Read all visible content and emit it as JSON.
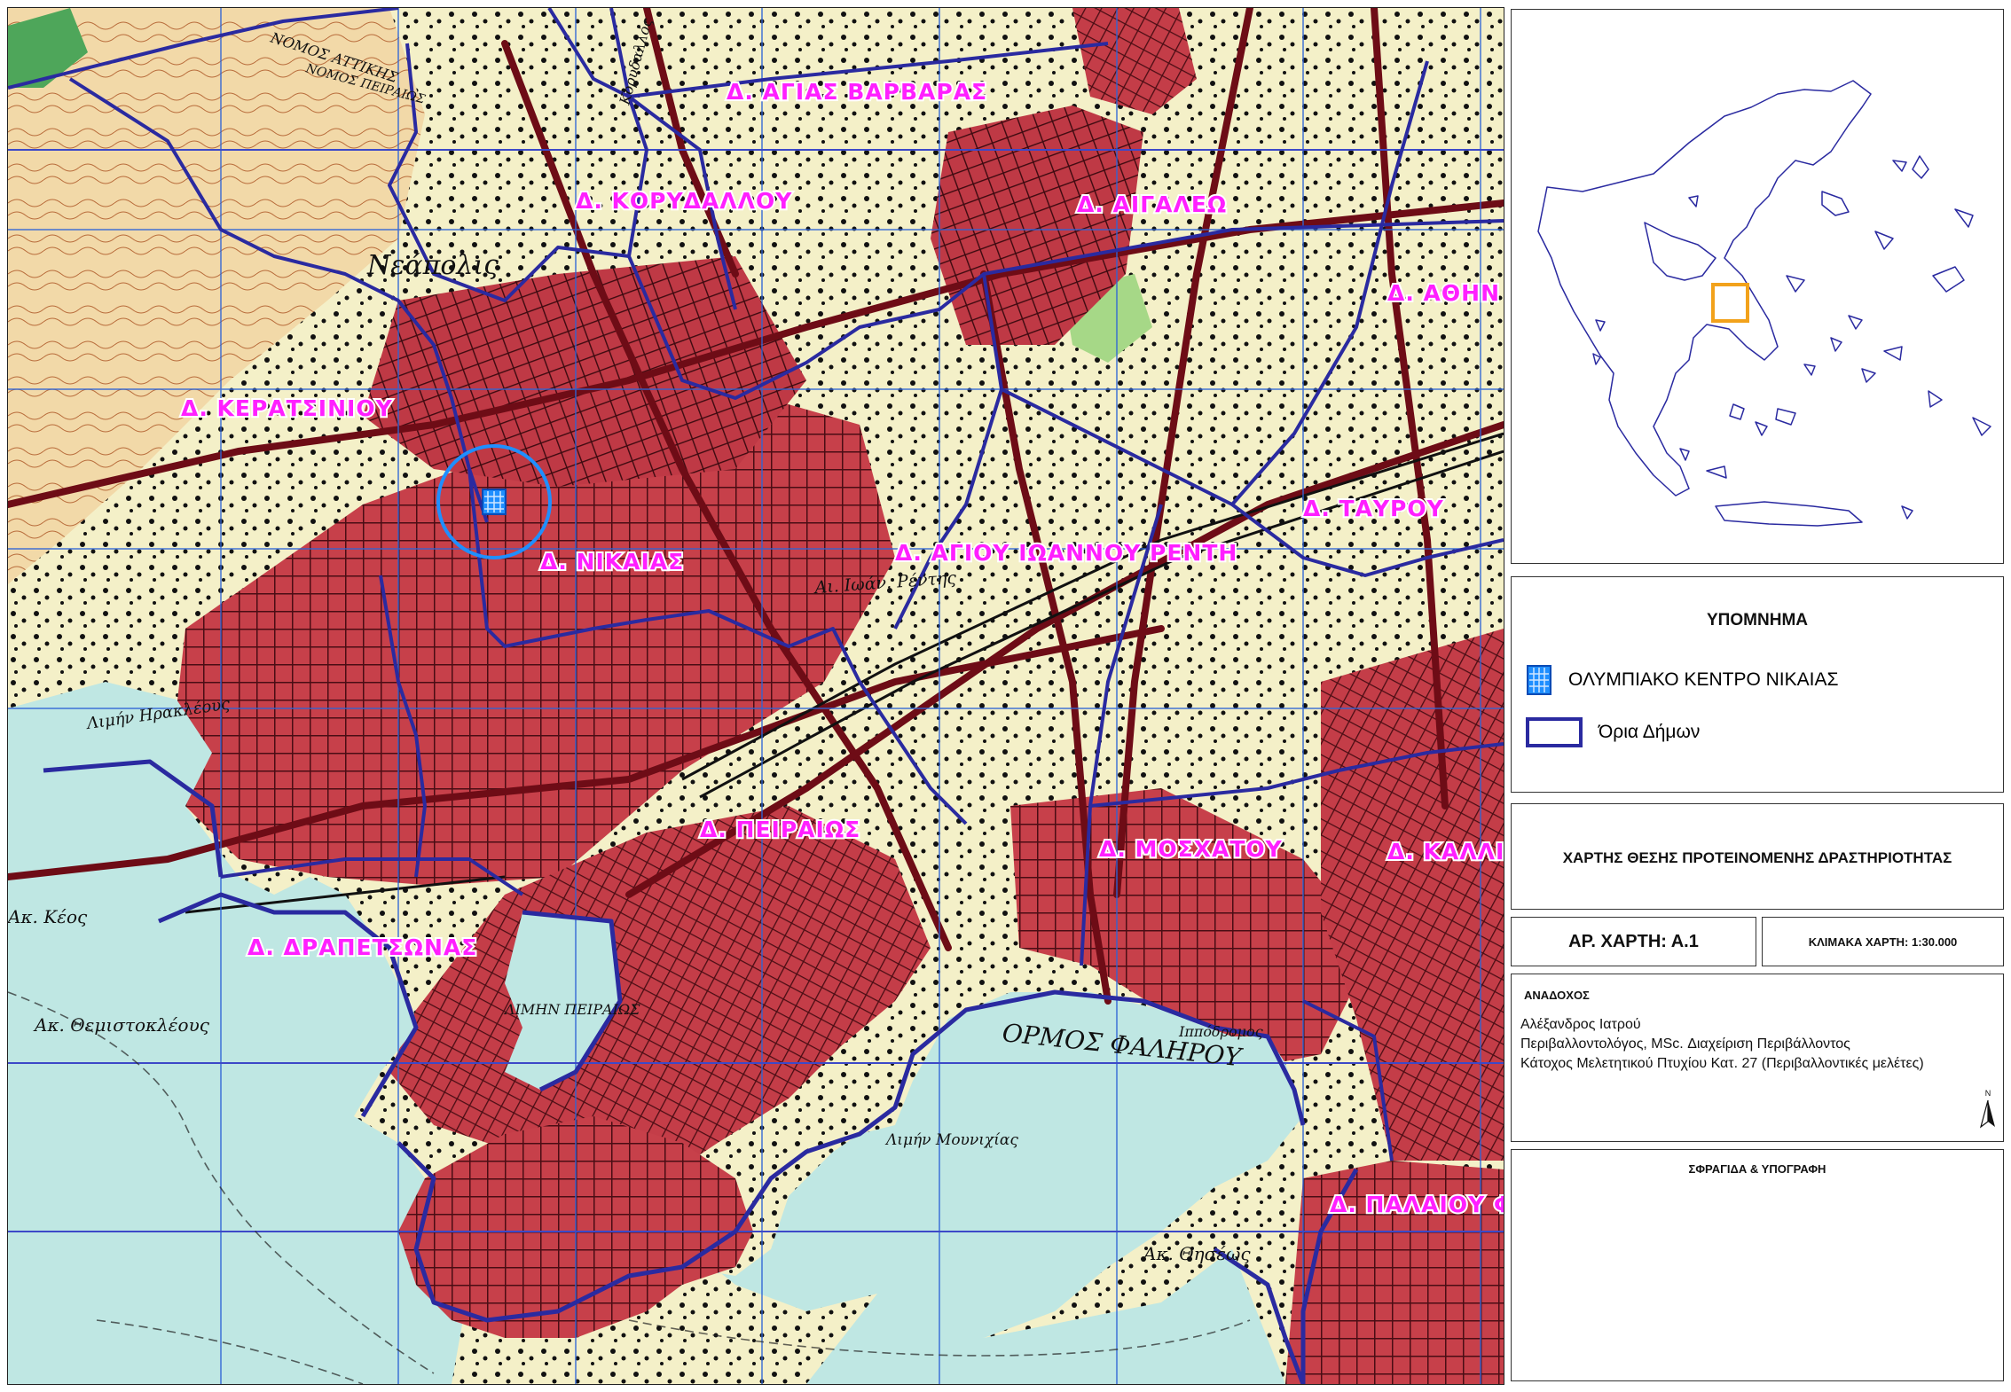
{
  "map": {
    "municipalities": [
      {
        "label": "Δ. ΑΓΙΑΣ ΒΑΡΒΑΡΑΣ"
      },
      {
        "label": "Δ. ΚΟΡΥΔΑΛΛΟΥ"
      },
      {
        "label": "Δ. ΑΙΓΑΛΕΩ"
      },
      {
        "label": "Δ. ΑΘΗΝ"
      },
      {
        "label": "Δ. ΚΕΡΑΤΣΙΝΙΟΥ"
      },
      {
        "label": "Δ. ΝΙΚΑΙΑΣ"
      },
      {
        "label": "Δ. ΑΓΙΟΥ ΙΩΑΝΝΟΥ ΡΕΝΤΗ"
      },
      {
        "label": "Δ. ΤΑΥΡΟΥ"
      },
      {
        "label": "Δ. ΠΕΙΡΑΙΩΣ"
      },
      {
        "label": "Δ. ΜΟΣΧΑΤΟΥ"
      },
      {
        "label": "Δ. ΚΑΛΛΙ"
      },
      {
        "label": "Δ. ΔΡΑΠΕΤΣΩΝΑΣ"
      },
      {
        "label": "Δ. ΠΑΛΑΙΟΥ Φ"
      }
    ],
    "topo_labels": [
      {
        "text": "Νεάπολις"
      },
      {
        "text": "Λιμήν Ηρακλέους"
      },
      {
        "text": "Ακ. Κέος"
      },
      {
        "text": "Ακ. Θεμιστοκλέους"
      },
      {
        "text": "ΛΙΜΗΝ ΠΕΙΡΑΙΩΣ"
      },
      {
        "text": "ΟΡΜΟΣ ΦΑΛΗΡΟΥ"
      },
      {
        "text": "Ιππόδρομος"
      },
      {
        "text": "Ακ. Θησέως"
      },
      {
        "text": "ΝΟΜΟΣ ΑΤΤΙΚΗΣ"
      },
      {
        "text": "ΝΟΜΟΣ ΠΕΙΡΑΙΩΣ"
      },
      {
        "text": "Αι. Ιωάν. Ρέντης"
      },
      {
        "text": "Κορυδαλλός"
      },
      {
        "text": "Λιμήν Μουνιχίας"
      }
    ],
    "marker_color": "#1f8fff",
    "boundary_color": "#2a2aa0",
    "label_color": "#ff1fff"
  },
  "inset": {
    "highlight_color": "#f2a21b",
    "outline_color": "#2a2aa0"
  },
  "legend": {
    "title": "ΥΠΟΜΝΗΜΑ",
    "items": [
      {
        "icon": "olympic-center-icon",
        "label": "ΟΛΥΜΠΙΑΚΟ ΚΕΝΤΡΟ ΝΙΚΑΙΑΣ"
      },
      {
        "icon": "boundary-swatch",
        "label": "Όρια Δήμων"
      }
    ]
  },
  "title": "ΧΑΡΤΗΣ ΘΕΣΗΣ ΠΡΟΤΕΙΝΟΜΕΝΗΣ ΔΡΑΣΤΗΡΙΟΤΗΤΑΣ",
  "map_number": "ΑΡ. ΧΑΡΤΗ: Α.1",
  "scale": "ΚΛΙΜΑΚΑ ΧΑΡΤΗ: 1:30.000",
  "contractor": {
    "heading": "ΑΝΑΔΟΧΟΣ",
    "name": "Αλέξανδρος Ιατρού",
    "line1": "Περιβαλλοντολόγος, MSc. Διαχείριση Περιβάλλοντος",
    "line2": "Κάτοχος Μελετητικού Πτυχίου Κατ. 27 (Περιβαλλοντικές μελέτες)",
    "north_label": "N"
  },
  "stamp": {
    "heading": "ΣΦΡΑΓΙΔΑ & ΥΠΟΓΡΑΦΗ"
  }
}
